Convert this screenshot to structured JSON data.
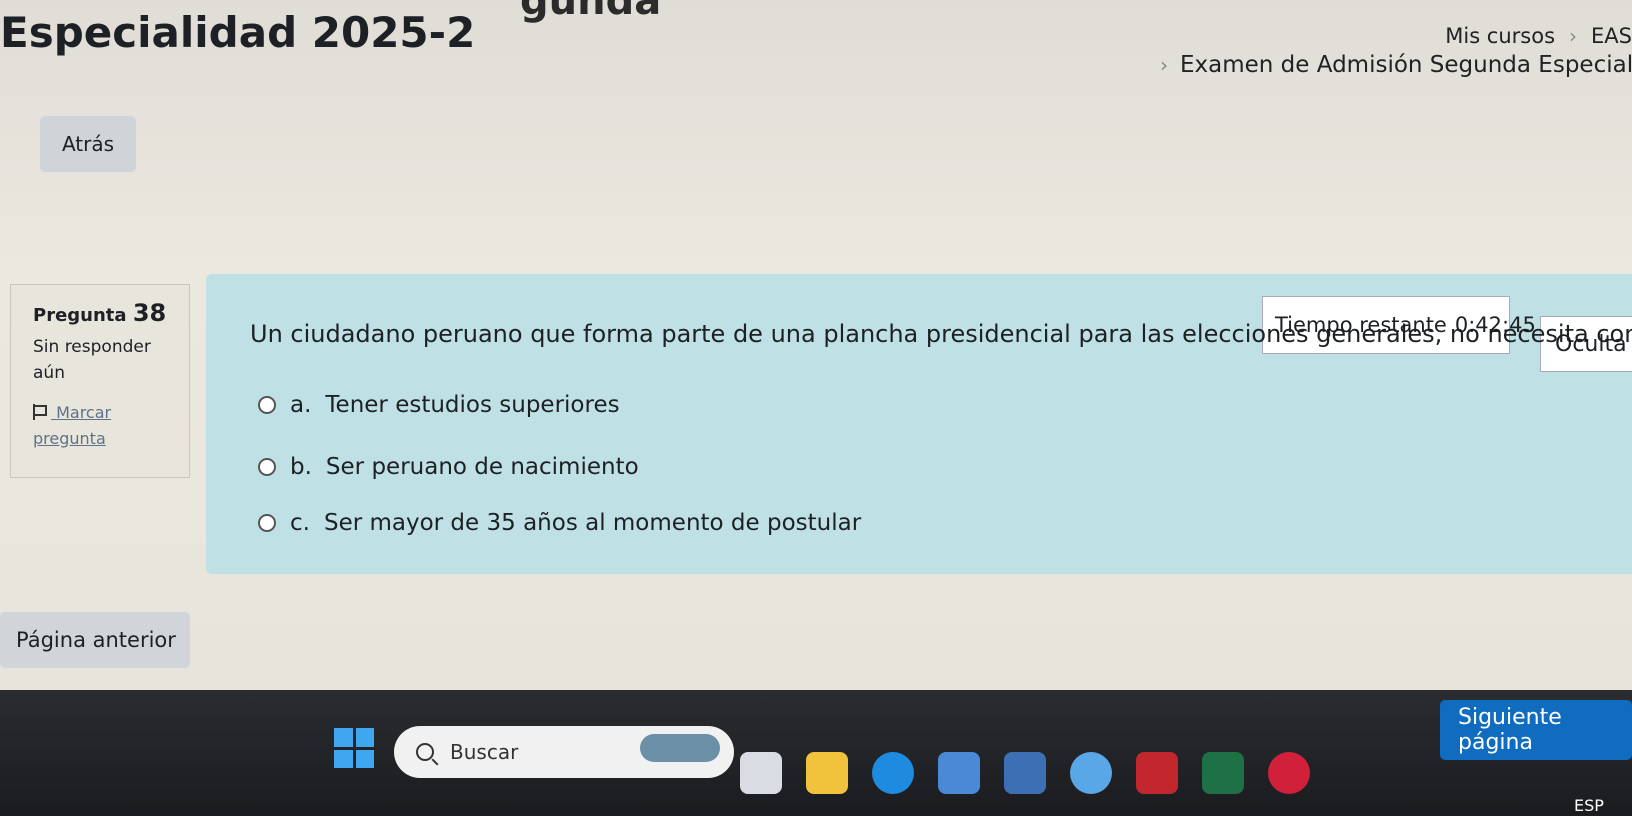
{
  "header": {
    "title": "Especialidad 2025-2",
    "ghost_title": "gunda",
    "breadcrumb": [
      "Mis cursos",
      "EAS"
    ],
    "breadcrumb_sub": "Examen de Admisión Segunda Especialidad"
  },
  "nav": {
    "back_label": "Atrás"
  },
  "question": {
    "label": "Pregunta",
    "number": "38",
    "state": "Sin responder aún",
    "flag_label": "Marcar pregunta",
    "text": "Un ciudadano peruano que forma parte de una plancha presidencial para las elecciones generales, no necesita como requisito:",
    "answers": [
      {
        "letter": "a.",
        "text": "Tener estudios superiores"
      },
      {
        "letter": "b.",
        "text": "Ser peruano de nacimiento"
      },
      {
        "letter": "c.",
        "text": "Ser mayor de 35 años al momento de postular"
      }
    ]
  },
  "timer": {
    "label": "Tiempo restante",
    "value": "0:42:45",
    "hide_label": "Oculta"
  },
  "footer": {
    "prev_label": "Página anterior",
    "next_label": "Siguiente página"
  },
  "taskbar": {
    "search_placeholder": "Buscar",
    "lang": "ESP",
    "icons": [
      "windows-start-icon",
      "widgets-icon",
      "task-view-icon",
      "file-explorer-icon",
      "edge-icon",
      "store-icon",
      "meet-icon",
      "chrome-icon",
      "mcafee-icon",
      "excel-icon",
      "opera-icon"
    ],
    "colors": {
      "start": "#3fa7f0",
      "accent": "#0f6cbf"
    }
  }
}
